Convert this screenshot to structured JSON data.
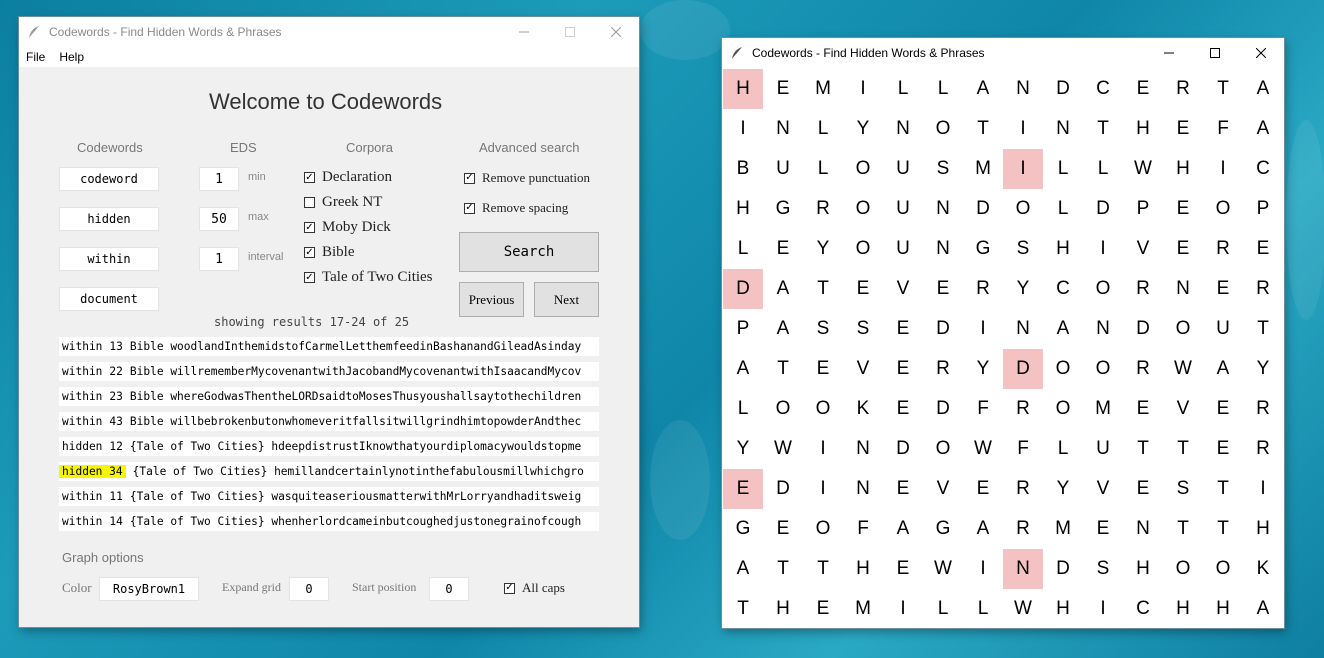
{
  "left_window": {
    "title": "Codewords - Find Hidden Words & Phrases",
    "menu": [
      "File",
      "Help"
    ],
    "heading": "Welcome to Codewords",
    "columns": {
      "codewords": "Codewords",
      "eds": "EDS",
      "corpora": "Corpora",
      "advanced": "Advanced search"
    },
    "codewords": [
      "codeword",
      "hidden",
      "within",
      "document"
    ],
    "eds": {
      "min_value": "1",
      "min_label": "min",
      "max_value": "50",
      "max_label": "max",
      "interval_value": "1",
      "interval_label": "interval"
    },
    "corpora": [
      {
        "label": "Declaration",
        "checked": true
      },
      {
        "label": "Greek NT",
        "checked": false
      },
      {
        "label": "Moby Dick",
        "checked": true
      },
      {
        "label": "Bible",
        "checked": true
      },
      {
        "label": "Tale of Two Cities",
        "checked": true
      }
    ],
    "advanced": [
      {
        "label": "Remove punctuation",
        "checked": true
      },
      {
        "label": "Remove spacing",
        "checked": true
      }
    ],
    "search_button": "Search",
    "previous_button": "Previous",
    "next_button": "Next",
    "results_label": "showing results 17-24 of 25",
    "results": [
      {
        "word": "within",
        "skip": "13",
        "rest": "Bible woodlandInthemidstofCarmelLetthemfeedinBashanandGileadAsinday",
        "highlight": false
      },
      {
        "word": "within",
        "skip": "22",
        "rest": "Bible willrememberMycovenantwithJacobandMycovenantwithIsaacandMycov",
        "highlight": false
      },
      {
        "word": "within",
        "skip": "23",
        "rest": "Bible whereGodwasThentheLORDsaidtoMosesThusyoushallsaytothechildren",
        "highlight": false
      },
      {
        "word": "within",
        "skip": "43",
        "rest": "Bible willbebrokenbutonwhomeveritfallsitwillgrindhimtopowderAndthec",
        "highlight": false
      },
      {
        "word": "hidden",
        "skip": "12",
        "rest": "{Tale of Two Cities} hdeepdistrustIknowthatyourdiplomacywouldstopme",
        "highlight": false
      },
      {
        "word": "hidden",
        "skip": "34",
        "rest": "{Tale of Two Cities} hemillandcertainlynotinthefabulousmillwhichgro",
        "highlight": true
      },
      {
        "word": "within",
        "skip": "11",
        "rest": "{Tale of Two Cities} wasquiteaseriousmatterwithMrLorryandhaditsweig",
        "highlight": false
      },
      {
        "word": "within",
        "skip": "14",
        "rest": "{Tale of Two Cities} whenherlordcameinbutcoughedjustonegrainofcough",
        "highlight": false
      }
    ],
    "graph_options": {
      "title": "Graph options",
      "color_label": "Color",
      "color_value": "RosyBrown1",
      "expand_label": "Expand grid",
      "expand_value": "0",
      "start_label": "Start position",
      "start_value": "0",
      "allcaps_label": "All caps",
      "allcaps_checked": true
    }
  },
  "right_window": {
    "title": "Codewords - Find Hidden Words & Phrases",
    "highlight_color": "#f4c2c2",
    "grid": [
      "HEMILLANDCERTA",
      "INLYNOTINTHEFA",
      "BULOUSMILLWHIC",
      "HGROUNDOLDPEOP",
      "LEYOUNGSHIVERE",
      "DATEVERYCORNER",
      "PASSEDINANDOUT",
      "ATEVERYDOORWAY",
      "LOOKEDFROMEVER",
      "YWINDOWFLUTTER",
      "EDINEVERYVESTI",
      "GEOFAGARMENTTH",
      "ATTHEWINDSHOOK",
      "THEMILLWHICHHA"
    ],
    "highlighted_cells": [
      [
        0,
        0
      ],
      [
        2,
        7
      ],
      [
        5,
        0
      ],
      [
        7,
        7
      ],
      [
        10,
        0
      ],
      [
        12,
        7
      ]
    ]
  }
}
